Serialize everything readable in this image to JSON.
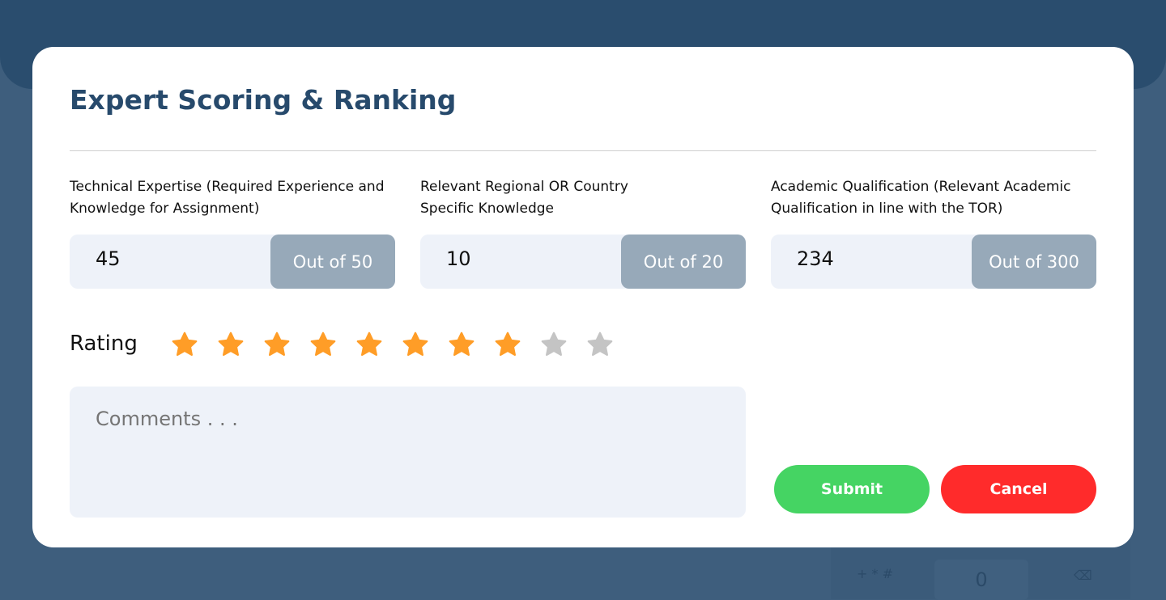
{
  "modal": {
    "title": "Expert Scoring & Ranking",
    "fields": [
      {
        "label": "Technical Expertise (Required Experience and Knowledge for Assignment)",
        "value": "45",
        "suffix": "Out of 50"
      },
      {
        "label": "Relevant Regional OR Country Specific Knowledge",
        "value": "10",
        "suffix": "Out of 20"
      },
      {
        "label": "Academic Qualification (Relevant Academic Qualification in line with the TOR)",
        "value": "234",
        "suffix": "Out of 300"
      }
    ],
    "rating": {
      "label": "Rating",
      "value": 8,
      "max": 10,
      "filled_color": "#ff9d27",
      "empty_color": "#c4c4c4"
    },
    "comments_placeholder": "Comments . . .",
    "submit_label": "Submit",
    "cancel_label": "Cancel",
    "colors": {
      "submit": "#45d463",
      "cancel": "#ff2b2b",
      "title": "#274a6c"
    }
  },
  "background_keypad": {
    "symbols": "+ * #",
    "zero": "0",
    "icon": "backspace-icon"
  }
}
